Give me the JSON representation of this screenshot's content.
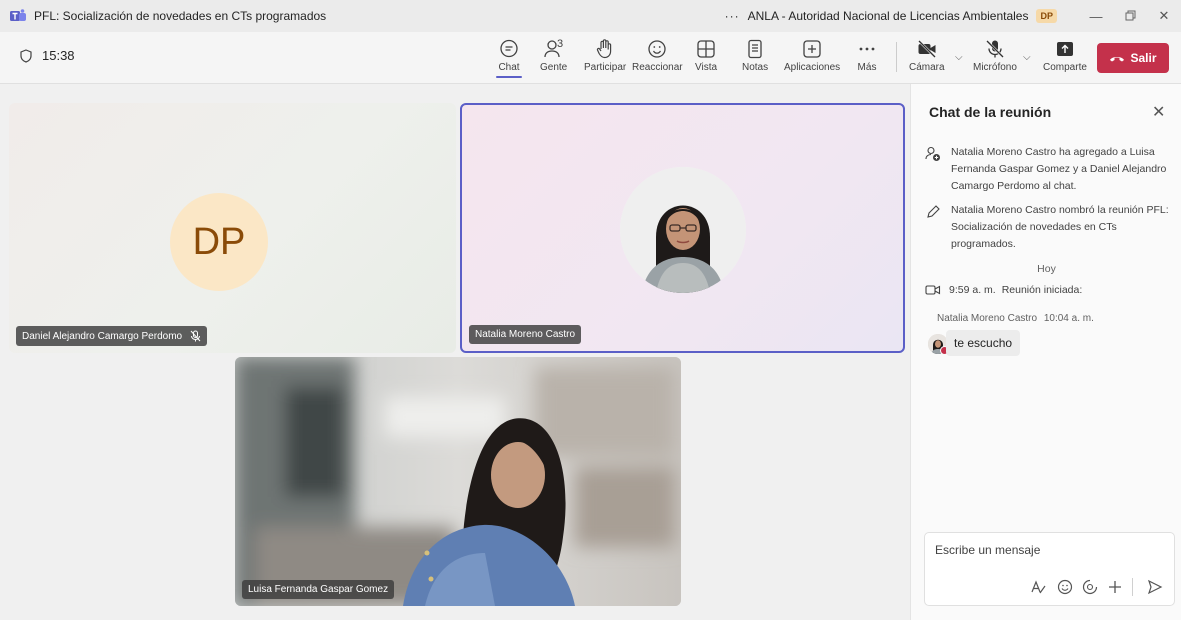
{
  "window": {
    "title": "PFL: Socialización de novedades en CTs programados",
    "more": "···",
    "org": "ANLA - Autoridad Nacional de Licencias Ambientales",
    "user_badge": "DP"
  },
  "toolbar": {
    "timer": "15:38",
    "people_count": "3",
    "buttons": {
      "chat": "Chat",
      "people": "Gente",
      "raise": "Participar",
      "react": "Reaccionar",
      "view": "Vista",
      "notes": "Notas",
      "apps": "Aplicaciones",
      "more": "Más",
      "camera": "Cámara",
      "mic": "Micrófono",
      "share": "Comparte"
    },
    "leave": "Salir"
  },
  "participants": [
    {
      "name": "Daniel Alejandro Camargo Perdomo",
      "initials": "DP",
      "muted": true
    },
    {
      "name": "Natalia Moreno Castro",
      "active": true
    },
    {
      "name": "Luisa Fernanda Gaspar Gomez"
    }
  ],
  "chat": {
    "title": "Chat de la reunión",
    "events": [
      {
        "icon": "person-add-icon",
        "text": "Natalia Moreno Castro ha agregado a Luisa Fernanda Gaspar Gomez y a Daniel Alejandro Camargo Perdomo al chat."
      },
      {
        "icon": "pencil-icon",
        "text": "Natalia Moreno Castro nombró la reunión PFL: Socialización de novedades en CTs programados."
      }
    ],
    "date_separator": "Hoy",
    "system": {
      "time": "9:59 a. m.",
      "text": "Reunión iniciada:"
    },
    "message": {
      "sender": "Natalia Moreno Castro",
      "time": "10:04 a. m.",
      "text": "te escucho"
    },
    "composer_placeholder": "Escribe un mensaje"
  },
  "colors": {
    "accent": "#5b5fc7",
    "leave": "#c4314b"
  }
}
